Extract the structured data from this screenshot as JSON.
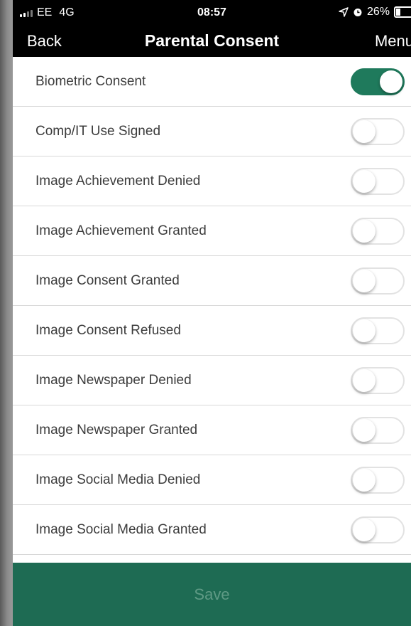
{
  "status_bar": {
    "carrier": "EE",
    "network": "4G",
    "time": "08:57",
    "battery": "26%",
    "icons": [
      "signal-icon",
      "location-icon",
      "alarm-icon",
      "battery-icon"
    ]
  },
  "nav": {
    "back_label": "Back",
    "title": "Parental Consent",
    "menu_label": "Menu"
  },
  "consents": [
    {
      "label": "Biometric Consent",
      "on": true
    },
    {
      "label": "Comp/IT Use Signed",
      "on": false
    },
    {
      "label": "Image Achievement Denied",
      "on": false
    },
    {
      "label": "Image Achievement Granted",
      "on": false
    },
    {
      "label": "Image Consent Granted",
      "on": false
    },
    {
      "label": "Image Consent Refused",
      "on": false
    },
    {
      "label": "Image Newspaper Denied",
      "on": false
    },
    {
      "label": "Image Newspaper Granted",
      "on": false
    },
    {
      "label": "Image Social Media Denied",
      "on": false
    },
    {
      "label": "Image Social Media Granted",
      "on": false
    }
  ],
  "save_label": "Save",
  "colors": {
    "accent": "#1f7a5c",
    "save_bar": "#1e6b53",
    "save_text": "#5f9a85"
  }
}
